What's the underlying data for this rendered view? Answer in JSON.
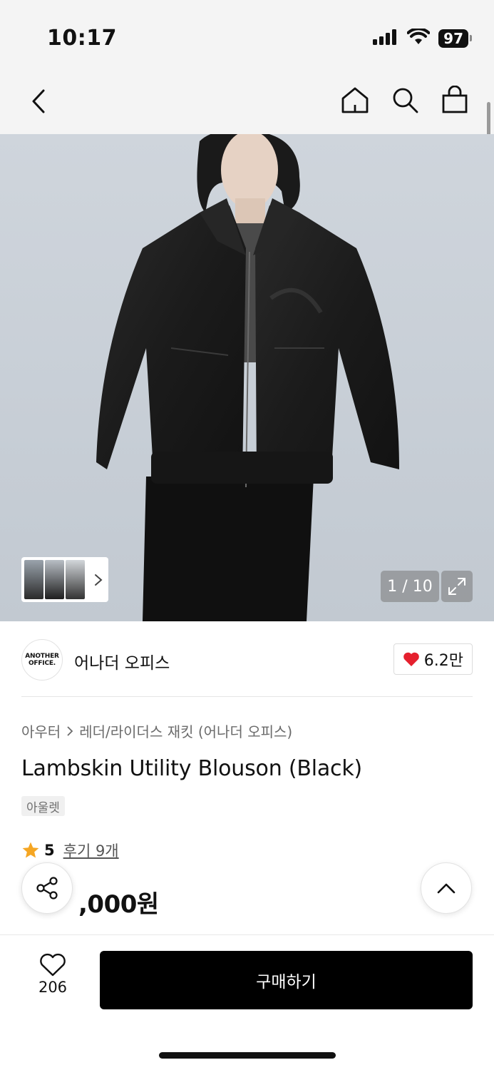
{
  "status_bar": {
    "time": "10:17",
    "battery": "97",
    "icons": [
      "signal-icon",
      "wifi-icon",
      "battery-icon"
    ]
  },
  "nav": {
    "icons": [
      "chevron-left-icon",
      "home-icon",
      "search-icon",
      "shopping-bag-icon"
    ]
  },
  "gallery": {
    "counter": "1 / 10",
    "icons": [
      "chevron-right-icon",
      "expand-icon"
    ]
  },
  "brand": {
    "logo_line1": "ANOTHER",
    "logo_line2": "OFFICE.",
    "name": "어나더 오피스",
    "likes": "6.2만",
    "like_color": "#e5202e"
  },
  "product": {
    "breadcrumb_category": "아우터",
    "breadcrumb_sub": "레더/라이더스 재킷 (어나더 오피스)",
    "title": "Lambskin Utility Blouson (Black)",
    "tag": "아울렛",
    "rating_score": "5",
    "reviews": "후기 9개",
    "price_visible": ",000원",
    "star_color": "#f5a623"
  },
  "bottom_bar": {
    "wish_count": "206",
    "buy_label": "구매하기"
  }
}
